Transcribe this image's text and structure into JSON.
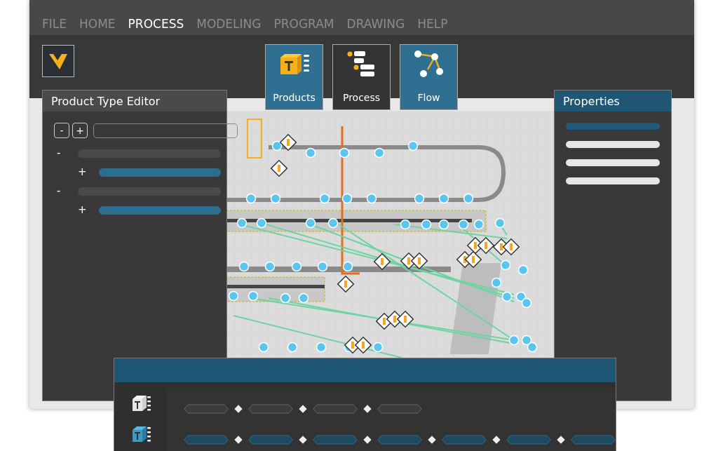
{
  "menu": [
    {
      "label": "FILE",
      "selected": false
    },
    {
      "label": "HOME",
      "selected": false
    },
    {
      "label": "PROCESS",
      "selected": true
    },
    {
      "label": "MODELING",
      "selected": false
    },
    {
      "label": "PROGRAM",
      "selected": false
    },
    {
      "label": "DRAWING",
      "selected": false
    },
    {
      "label": "HELP",
      "selected": false
    }
  ],
  "ribbon": [
    {
      "label": "Products",
      "kind": "products",
      "selected": true
    },
    {
      "label": "Process",
      "kind": "process",
      "selected": false
    },
    {
      "label": "Flow",
      "kind": "flow",
      "selected": true
    }
  ],
  "product_type_editor": {
    "title": "Product Type Editor",
    "collapse_button": "-",
    "expand_button": "+",
    "tree": [
      {
        "toggle": "-",
        "children": [
          {
            "toggle": "+"
          }
        ]
      },
      {
        "toggle": "-",
        "children": [
          {
            "toggle": "+"
          }
        ]
      }
    ]
  },
  "properties": {
    "title": "Properties",
    "rows": [
      {
        "selected": true
      },
      {
        "selected": false
      },
      {
        "selected": false
      },
      {
        "selected": false
      }
    ]
  },
  "timeline": {
    "rows": [
      {
        "kind": "product",
        "active": false,
        "steps": [
          {
            "active": false
          },
          {
            "active": false
          },
          {
            "active": false
          },
          {
            "active": false
          }
        ]
      },
      {
        "kind": "product",
        "active": true,
        "steps": [
          {
            "active": true
          },
          {
            "active": true
          },
          {
            "active": true
          },
          {
            "active": true
          },
          {
            "active": true
          },
          {
            "active": true
          },
          {
            "active": true
          }
        ]
      }
    ]
  }
}
